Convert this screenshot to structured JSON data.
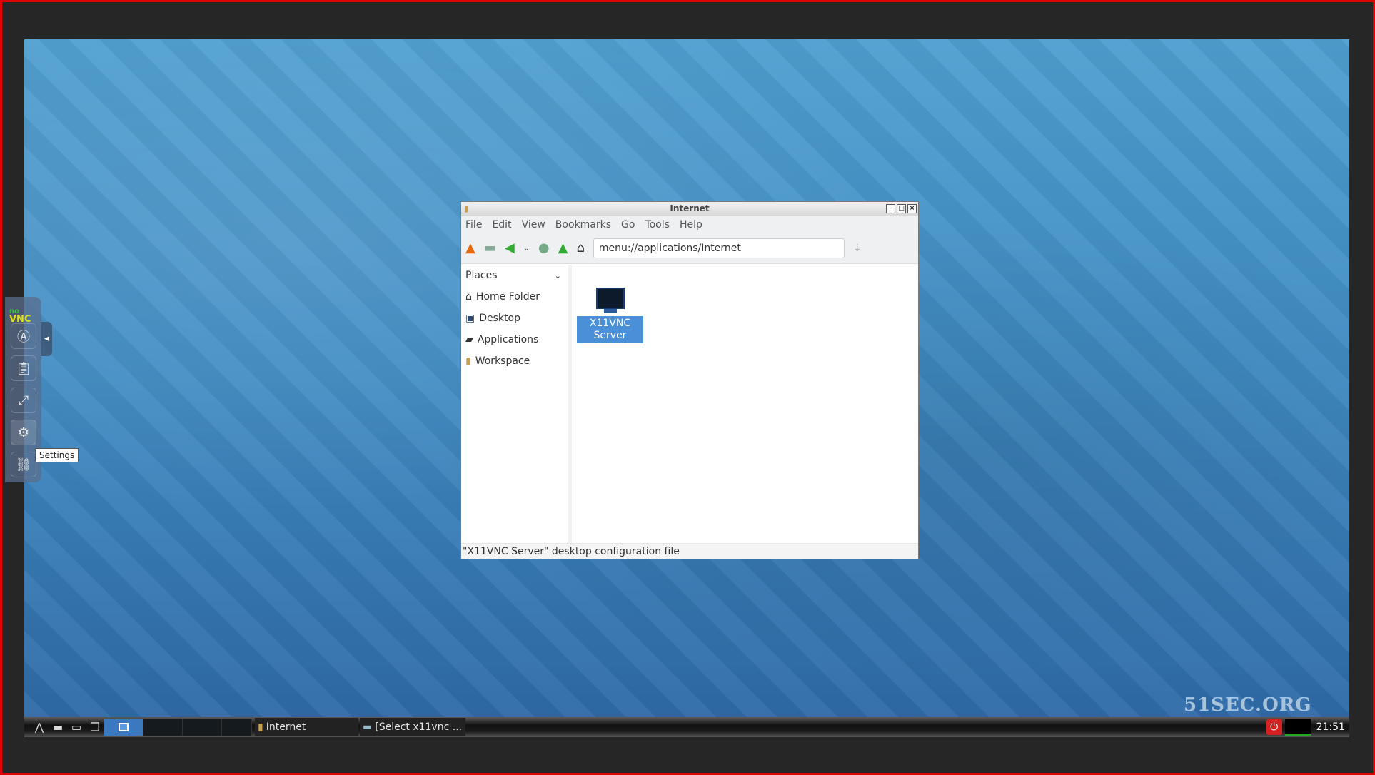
{
  "window": {
    "title": "Internet",
    "menu": [
      "File",
      "Edit",
      "View",
      "Bookmarks",
      "Go",
      "Tools",
      "Help"
    ],
    "address": "menu://applications/Internet",
    "status": "\"X11VNC Server\" desktop configuration file"
  },
  "sidebar": {
    "header": "Places",
    "items": [
      {
        "label": "Home Folder",
        "icon": "home-icon"
      },
      {
        "label": "Desktop",
        "icon": "desktop-icon"
      },
      {
        "label": "Applications",
        "icon": "applications-icon"
      },
      {
        "label": "Workspace",
        "icon": "folder-icon"
      }
    ]
  },
  "files": [
    {
      "label": "X11VNC Server",
      "icon": "monitor-icon",
      "selected": true
    }
  ],
  "novnc": {
    "logo": "noVNC",
    "tooltip": "Settings"
  },
  "taskbar": {
    "tasks": [
      "Internet",
      "[Select x11vnc ..."
    ],
    "clock": "21:51"
  },
  "watermark": "51SEC.ORG",
  "colors": {
    "accent": "#4a90d9",
    "frame": "#e00000",
    "power": "#d42020"
  }
}
